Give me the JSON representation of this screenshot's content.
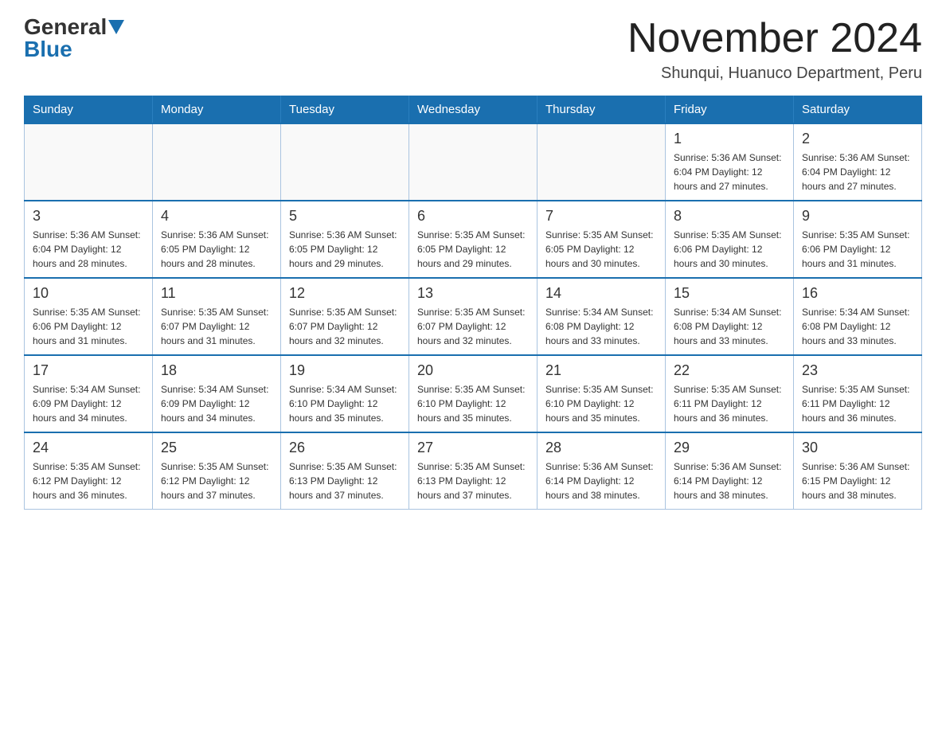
{
  "header": {
    "logo_general": "General",
    "logo_blue": "Blue",
    "month_title": "November 2024",
    "location": "Shunqui, Huanuco Department, Peru"
  },
  "calendar": {
    "days_of_week": [
      "Sunday",
      "Monday",
      "Tuesday",
      "Wednesday",
      "Thursday",
      "Friday",
      "Saturday"
    ],
    "weeks": [
      [
        {
          "day": "",
          "info": ""
        },
        {
          "day": "",
          "info": ""
        },
        {
          "day": "",
          "info": ""
        },
        {
          "day": "",
          "info": ""
        },
        {
          "day": "",
          "info": ""
        },
        {
          "day": "1",
          "info": "Sunrise: 5:36 AM\nSunset: 6:04 PM\nDaylight: 12 hours\nand 27 minutes."
        },
        {
          "day": "2",
          "info": "Sunrise: 5:36 AM\nSunset: 6:04 PM\nDaylight: 12 hours\nand 27 minutes."
        }
      ],
      [
        {
          "day": "3",
          "info": "Sunrise: 5:36 AM\nSunset: 6:04 PM\nDaylight: 12 hours\nand 28 minutes."
        },
        {
          "day": "4",
          "info": "Sunrise: 5:36 AM\nSunset: 6:05 PM\nDaylight: 12 hours\nand 28 minutes."
        },
        {
          "day": "5",
          "info": "Sunrise: 5:36 AM\nSunset: 6:05 PM\nDaylight: 12 hours\nand 29 minutes."
        },
        {
          "day": "6",
          "info": "Sunrise: 5:35 AM\nSunset: 6:05 PM\nDaylight: 12 hours\nand 29 minutes."
        },
        {
          "day": "7",
          "info": "Sunrise: 5:35 AM\nSunset: 6:05 PM\nDaylight: 12 hours\nand 30 minutes."
        },
        {
          "day": "8",
          "info": "Sunrise: 5:35 AM\nSunset: 6:06 PM\nDaylight: 12 hours\nand 30 minutes."
        },
        {
          "day": "9",
          "info": "Sunrise: 5:35 AM\nSunset: 6:06 PM\nDaylight: 12 hours\nand 31 minutes."
        }
      ],
      [
        {
          "day": "10",
          "info": "Sunrise: 5:35 AM\nSunset: 6:06 PM\nDaylight: 12 hours\nand 31 minutes."
        },
        {
          "day": "11",
          "info": "Sunrise: 5:35 AM\nSunset: 6:07 PM\nDaylight: 12 hours\nand 31 minutes."
        },
        {
          "day": "12",
          "info": "Sunrise: 5:35 AM\nSunset: 6:07 PM\nDaylight: 12 hours\nand 32 minutes."
        },
        {
          "day": "13",
          "info": "Sunrise: 5:35 AM\nSunset: 6:07 PM\nDaylight: 12 hours\nand 32 minutes."
        },
        {
          "day": "14",
          "info": "Sunrise: 5:34 AM\nSunset: 6:08 PM\nDaylight: 12 hours\nand 33 minutes."
        },
        {
          "day": "15",
          "info": "Sunrise: 5:34 AM\nSunset: 6:08 PM\nDaylight: 12 hours\nand 33 minutes."
        },
        {
          "day": "16",
          "info": "Sunrise: 5:34 AM\nSunset: 6:08 PM\nDaylight: 12 hours\nand 33 minutes."
        }
      ],
      [
        {
          "day": "17",
          "info": "Sunrise: 5:34 AM\nSunset: 6:09 PM\nDaylight: 12 hours\nand 34 minutes."
        },
        {
          "day": "18",
          "info": "Sunrise: 5:34 AM\nSunset: 6:09 PM\nDaylight: 12 hours\nand 34 minutes."
        },
        {
          "day": "19",
          "info": "Sunrise: 5:34 AM\nSunset: 6:10 PM\nDaylight: 12 hours\nand 35 minutes."
        },
        {
          "day": "20",
          "info": "Sunrise: 5:35 AM\nSunset: 6:10 PM\nDaylight: 12 hours\nand 35 minutes."
        },
        {
          "day": "21",
          "info": "Sunrise: 5:35 AM\nSunset: 6:10 PM\nDaylight: 12 hours\nand 35 minutes."
        },
        {
          "day": "22",
          "info": "Sunrise: 5:35 AM\nSunset: 6:11 PM\nDaylight: 12 hours\nand 36 minutes."
        },
        {
          "day": "23",
          "info": "Sunrise: 5:35 AM\nSunset: 6:11 PM\nDaylight: 12 hours\nand 36 minutes."
        }
      ],
      [
        {
          "day": "24",
          "info": "Sunrise: 5:35 AM\nSunset: 6:12 PM\nDaylight: 12 hours\nand 36 minutes."
        },
        {
          "day": "25",
          "info": "Sunrise: 5:35 AM\nSunset: 6:12 PM\nDaylight: 12 hours\nand 37 minutes."
        },
        {
          "day": "26",
          "info": "Sunrise: 5:35 AM\nSunset: 6:13 PM\nDaylight: 12 hours\nand 37 minutes."
        },
        {
          "day": "27",
          "info": "Sunrise: 5:35 AM\nSunset: 6:13 PM\nDaylight: 12 hours\nand 37 minutes."
        },
        {
          "day": "28",
          "info": "Sunrise: 5:36 AM\nSunset: 6:14 PM\nDaylight: 12 hours\nand 38 minutes."
        },
        {
          "day": "29",
          "info": "Sunrise: 5:36 AM\nSunset: 6:14 PM\nDaylight: 12 hours\nand 38 minutes."
        },
        {
          "day": "30",
          "info": "Sunrise: 5:36 AM\nSunset: 6:15 PM\nDaylight: 12 hours\nand 38 minutes."
        }
      ]
    ]
  }
}
